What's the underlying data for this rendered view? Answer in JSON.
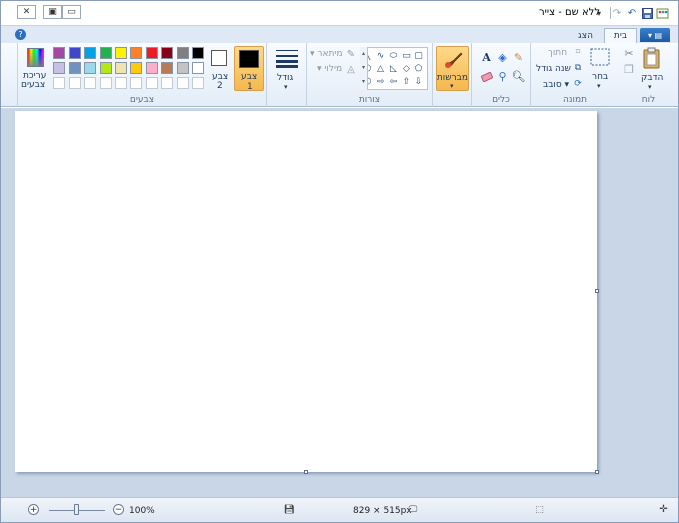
{
  "window": {
    "title": "ללא שם - צייר",
    "minimize_label": "▭",
    "maximize_label": "▣",
    "close_label": "✕"
  },
  "tabs": {
    "file_label": "▾ ▤",
    "items": [
      {
        "label": "בית",
        "active": true
      },
      {
        "label": "הצג",
        "active": false
      }
    ],
    "help_label": "?"
  },
  "ribbon": {
    "clipboard": {
      "group_label": "לוח",
      "paste_label": "הדבק",
      "paste_arrow": "▾"
    },
    "image": {
      "group_label": "תמונה",
      "select_label": "בחר",
      "select_arrow": "▾",
      "crop_label": "חתוך",
      "resize_label": "שנה גודל",
      "rotate_label": "▾ סובב"
    },
    "tools": {
      "group_label": "כלים"
    },
    "brushes": {
      "label": "מברשות",
      "arrow": "▾"
    },
    "shapes": {
      "group_label": "צורות",
      "outline_label": "מיתאר ▾",
      "fill_label": "מילוי ▾"
    },
    "size": {
      "label": "גודל",
      "arrow": "▾"
    },
    "colors": {
      "group_label": "צבעים",
      "color1_label_line1": "צבע",
      "color1_label_line2": "1",
      "color2_label_line1": "צבע",
      "color2_label_line2": "2",
      "edit_label_line1": "עריכת",
      "edit_label_line2": "צבעים",
      "color1": "#000000",
      "color2": "#ffffff",
      "palette_row1": [
        "#000000",
        "#7f7f7f",
        "#880015",
        "#ed1c24",
        "#ff7f27",
        "#fff200",
        "#22b14c",
        "#00a2e8",
        "#3f48cc",
        "#a349a4"
      ],
      "palette_row2": [
        "#ffffff",
        "#c3c3c3",
        "#b97a57",
        "#ffaec9",
        "#ffc90e",
        "#efe4b0",
        "#b5e61d",
        "#99d9ea",
        "#7092be",
        "#c8bfe7"
      ]
    }
  },
  "status": {
    "zoom": "100%",
    "dimensions": "829 × 515px"
  }
}
